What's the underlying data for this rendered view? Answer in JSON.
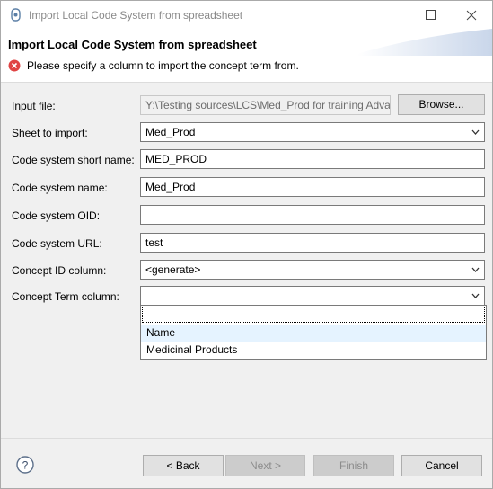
{
  "window": {
    "title": "Import Local Code System from spreadsheet"
  },
  "banner": {
    "title": "Import Local Code System from spreadsheet",
    "error_message": "Please specify a column to import the concept term from."
  },
  "form": {
    "input_file": {
      "label": "Input file:",
      "value": "Y:\\Testing sources\\LCS\\Med_Prod for training Adva",
      "browse_label": "Browse..."
    },
    "sheet": {
      "label": "Sheet to import:",
      "value": "Med_Prod"
    },
    "short_name": {
      "label": "Code system short name:",
      "value": "MED_PROD"
    },
    "name": {
      "label": "Code system name:",
      "value": "Med_Prod"
    },
    "oid": {
      "label": "Code system OID:",
      "value": ""
    },
    "url": {
      "label": "Code system URL:",
      "value": "test"
    },
    "concept_id": {
      "label": "Concept ID column:",
      "value": "<generate>"
    },
    "concept_term": {
      "label": "Concept Term column:",
      "value": ""
    }
  },
  "dropdown": {
    "options": [
      "",
      "Name",
      "Medicinal Products"
    ]
  },
  "footer": {
    "back": "< Back",
    "next": "Next >",
    "finish": "Finish",
    "cancel": "Cancel"
  },
  "colors": {
    "error_red": "#e04343",
    "hover_blue": "#e5f3ff"
  }
}
